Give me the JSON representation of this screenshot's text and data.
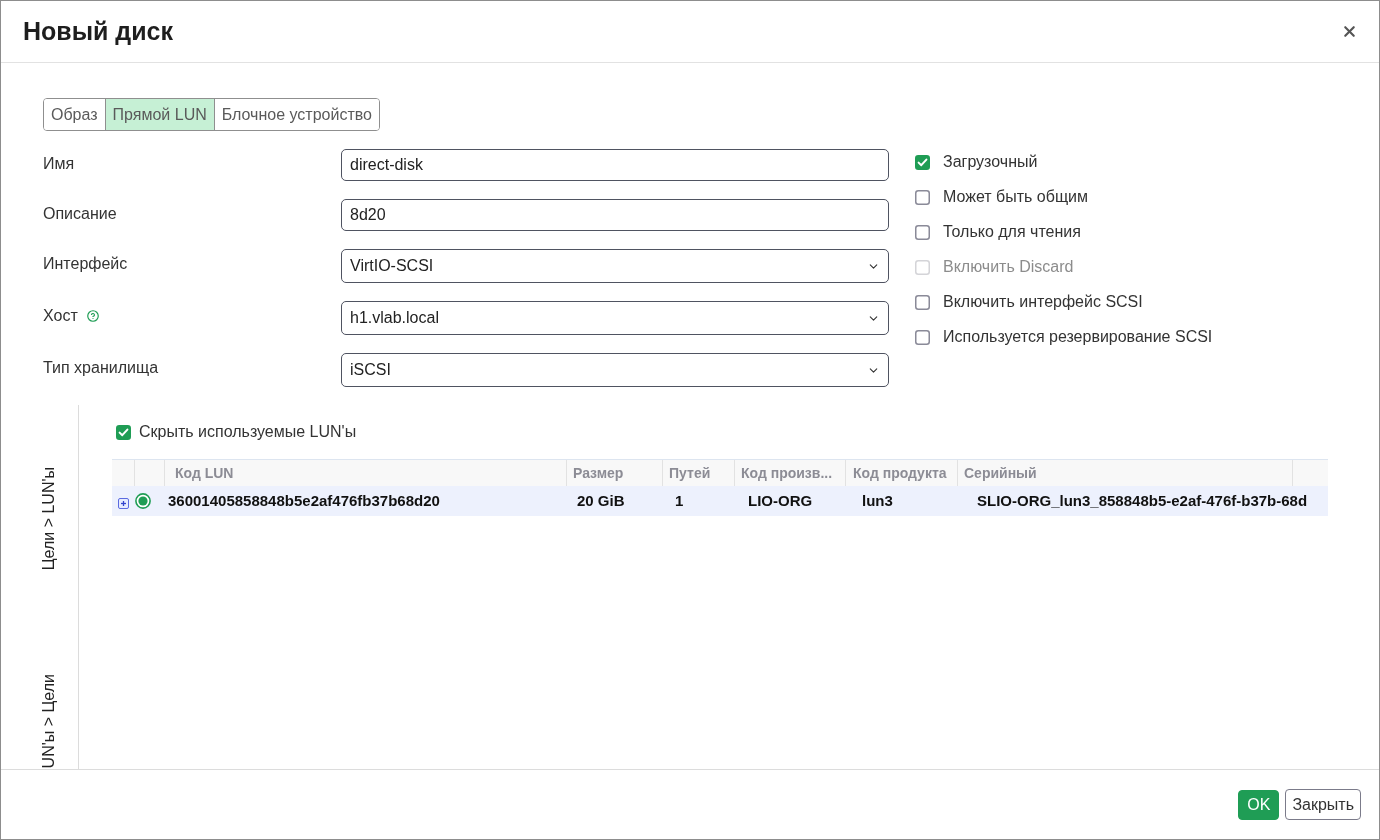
{
  "dialog": {
    "title": "Новый диск"
  },
  "tabs": [
    {
      "label": "Образ",
      "selected": false
    },
    {
      "label": "Прямой LUN",
      "selected": true
    },
    {
      "label": "Блочное устройство",
      "selected": false
    }
  ],
  "fields": [
    {
      "label": "Имя",
      "kind": "text",
      "value": "direct-disk",
      "help": false
    },
    {
      "label": "Описание",
      "kind": "text",
      "value": "8d20",
      "help": false
    },
    {
      "label": "Интерфейс",
      "kind": "select",
      "value": "VirtIO-SCSI",
      "help": false
    },
    {
      "label": "Хост",
      "kind": "select",
      "value": "h1.vlab.local",
      "help": true
    },
    {
      "label": "Тип хранилища",
      "kind": "select",
      "value": "iSCSI",
      "help": false
    }
  ],
  "options": [
    {
      "label": "Загрузочный",
      "checked": true,
      "disabled": false
    },
    {
      "label": "Может быть общим",
      "checked": false,
      "disabled": false
    },
    {
      "label": "Только для чтения",
      "checked": false,
      "disabled": false
    },
    {
      "label": "Включить Discard",
      "checked": false,
      "disabled": true
    },
    {
      "label": "Включить интерфейс SCSI",
      "checked": false,
      "disabled": false
    },
    {
      "label": "Используется резервирование SCSI",
      "checked": false,
      "disabled": false
    }
  ],
  "lun_panel": {
    "side_tabs": [
      {
        "label": "Цели > LUN'ы"
      },
      {
        "label": "UN'ы > Цели"
      }
    ],
    "hide_used": {
      "label": "Скрыть используемые LUN'ы",
      "checked": true
    },
    "table": {
      "columns": [
        "Код LUN",
        "Размер",
        "Путей",
        "Код произв...",
        "Код продукта",
        "Серийный"
      ],
      "rows": [
        {
          "expanded": false,
          "selected": true,
          "cells": [
            "36001405858848b5e2af476fb37b68d20",
            "20 GiB",
            "1",
            "LIO-ORG",
            "lun3",
            "SLIO-ORG_lun3_858848b5-e2af-476f-b37b-68d"
          ]
        }
      ]
    }
  },
  "buttons": [
    {
      "label": "OK",
      "kind": "primary"
    },
    {
      "label": "Закрыть",
      "kind": "secondary"
    }
  ]
}
